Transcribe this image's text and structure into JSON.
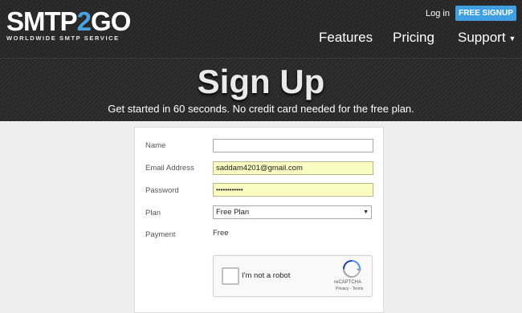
{
  "header": {
    "logo": {
      "main_before": "SMTP",
      "main_accent": "2",
      "main_after": "GO",
      "tagline": "WORLDWIDE SMTP SERVICE"
    },
    "login_label": "Log in",
    "signup_label": "FREE SIGNUP",
    "nav": [
      {
        "label": "Features"
      },
      {
        "label": "Pricing"
      },
      {
        "label": "Support"
      }
    ]
  },
  "hero": {
    "title": "Sign Up",
    "subtitle": "Get started in 60 seconds. No credit card needed for the free plan."
  },
  "form": {
    "name": {
      "label": "Name",
      "value": ""
    },
    "email": {
      "label": "Email Address",
      "value": "saddam4201@gmail.com"
    },
    "password": {
      "label": "Password",
      "value": "••••••••••••"
    },
    "plan": {
      "label": "Plan",
      "value": "Free Plan"
    },
    "payment": {
      "label": "Payment",
      "value": "Free"
    }
  },
  "captcha": {
    "label": "I'm not a robot",
    "brand": "reCAPTCHA",
    "links": "Privacy - Terms"
  },
  "colors": {
    "accent": "#3f9fe0",
    "autofill": "#fafcc1"
  }
}
